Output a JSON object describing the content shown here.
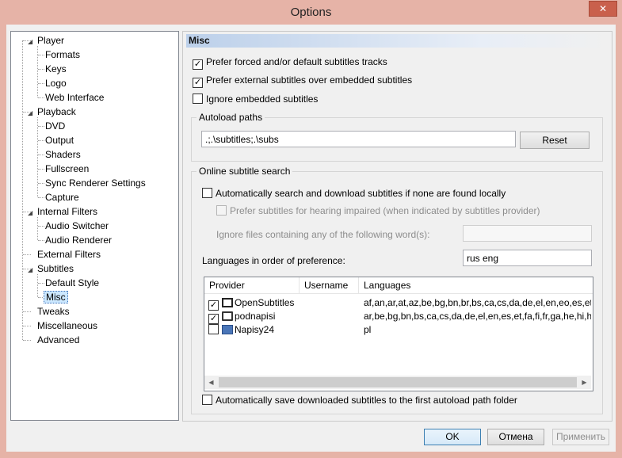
{
  "window": {
    "title": "Options",
    "close_glyph": "✕"
  },
  "tree": [
    {
      "label": "Player",
      "level": 0,
      "expander": "◢"
    },
    {
      "label": "Formats",
      "level": 1
    },
    {
      "label": "Keys",
      "level": 1
    },
    {
      "label": "Logo",
      "level": 1
    },
    {
      "label": "Web Interface",
      "level": 1
    },
    {
      "label": "Playback",
      "level": 0,
      "expander": "◢"
    },
    {
      "label": "DVD",
      "level": 1
    },
    {
      "label": "Output",
      "level": 1
    },
    {
      "label": "Shaders",
      "level": 1
    },
    {
      "label": "Fullscreen",
      "level": 1
    },
    {
      "label": "Sync Renderer Settings",
      "level": 1
    },
    {
      "label": "Capture",
      "level": 1
    },
    {
      "label": "Internal Filters",
      "level": 0,
      "expander": "◢"
    },
    {
      "label": "Audio Switcher",
      "level": 1
    },
    {
      "label": "Audio Renderer",
      "level": 1
    },
    {
      "label": "External Filters",
      "level": 0
    },
    {
      "label": "Subtitles",
      "level": 0,
      "expander": "◢"
    },
    {
      "label": "Default Style",
      "level": 1
    },
    {
      "label": "Misc",
      "level": 1,
      "selected": true
    },
    {
      "label": "Tweaks",
      "level": 0
    },
    {
      "label": "Miscellaneous",
      "level": 0
    },
    {
      "label": "Advanced",
      "level": 0
    }
  ],
  "panel": {
    "header": "Misc",
    "options": {
      "prefer_forced": {
        "label": "Prefer forced and/or default subtitles tracks",
        "checked": true
      },
      "prefer_external": {
        "label": "Prefer external subtitles over embedded subtitles",
        "checked": true
      },
      "ignore_embedded": {
        "label": "Ignore embedded subtitles",
        "checked": false
      }
    },
    "autoload": {
      "title": "Autoload paths",
      "value": ".;.\\subtitles;.\\subs",
      "reset_label": "Reset"
    },
    "online": {
      "title": "Online subtitle search",
      "auto_search": {
        "label": "Automatically search and download subtitles if none are found locally",
        "checked": false
      },
      "hearing_impaired": {
        "label": "Prefer subtitles for hearing impaired (when indicated by subtitles provider)",
        "checked": false
      },
      "ignore_words_label": "Ignore files containing any of the following word(s):",
      "ignore_words_value": "",
      "languages_label": "Languages in order of preference:",
      "languages_value": "rus eng",
      "columns": [
        "Provider",
        "Username",
        "Languages"
      ],
      "providers": [
        {
          "name": "OpenSubtitles",
          "checked": true,
          "username": "",
          "languages": "af,an,ar,at,az,be,bg,bn,br,bs,ca,cs,da,de,el,en,eo,es,et,eu,fa,fi"
        },
        {
          "name": "podnapisi",
          "checked": true,
          "username": "",
          "languages": "ar,be,bg,bn,bs,ca,cs,da,de,el,en,es,et,fa,fi,fr,ga,he,hi,hr,hu,id,is"
        },
        {
          "name": "Napisy24",
          "checked": false,
          "username": "",
          "languages": "pl"
        }
      ],
      "auto_save": {
        "label": "Automatically save downloaded subtitles to the first autoload path folder",
        "checked": false
      }
    }
  },
  "buttons": {
    "ok": "OK",
    "cancel": "Отмена",
    "apply": "Применить"
  },
  "check_glyph": "✓",
  "scroll": {
    "left": "◀",
    "right": "▶"
  },
  "colors": {
    "titlebar": "#e6b3a7",
    "close": "#c9604c",
    "selection": "#cce8ff"
  }
}
